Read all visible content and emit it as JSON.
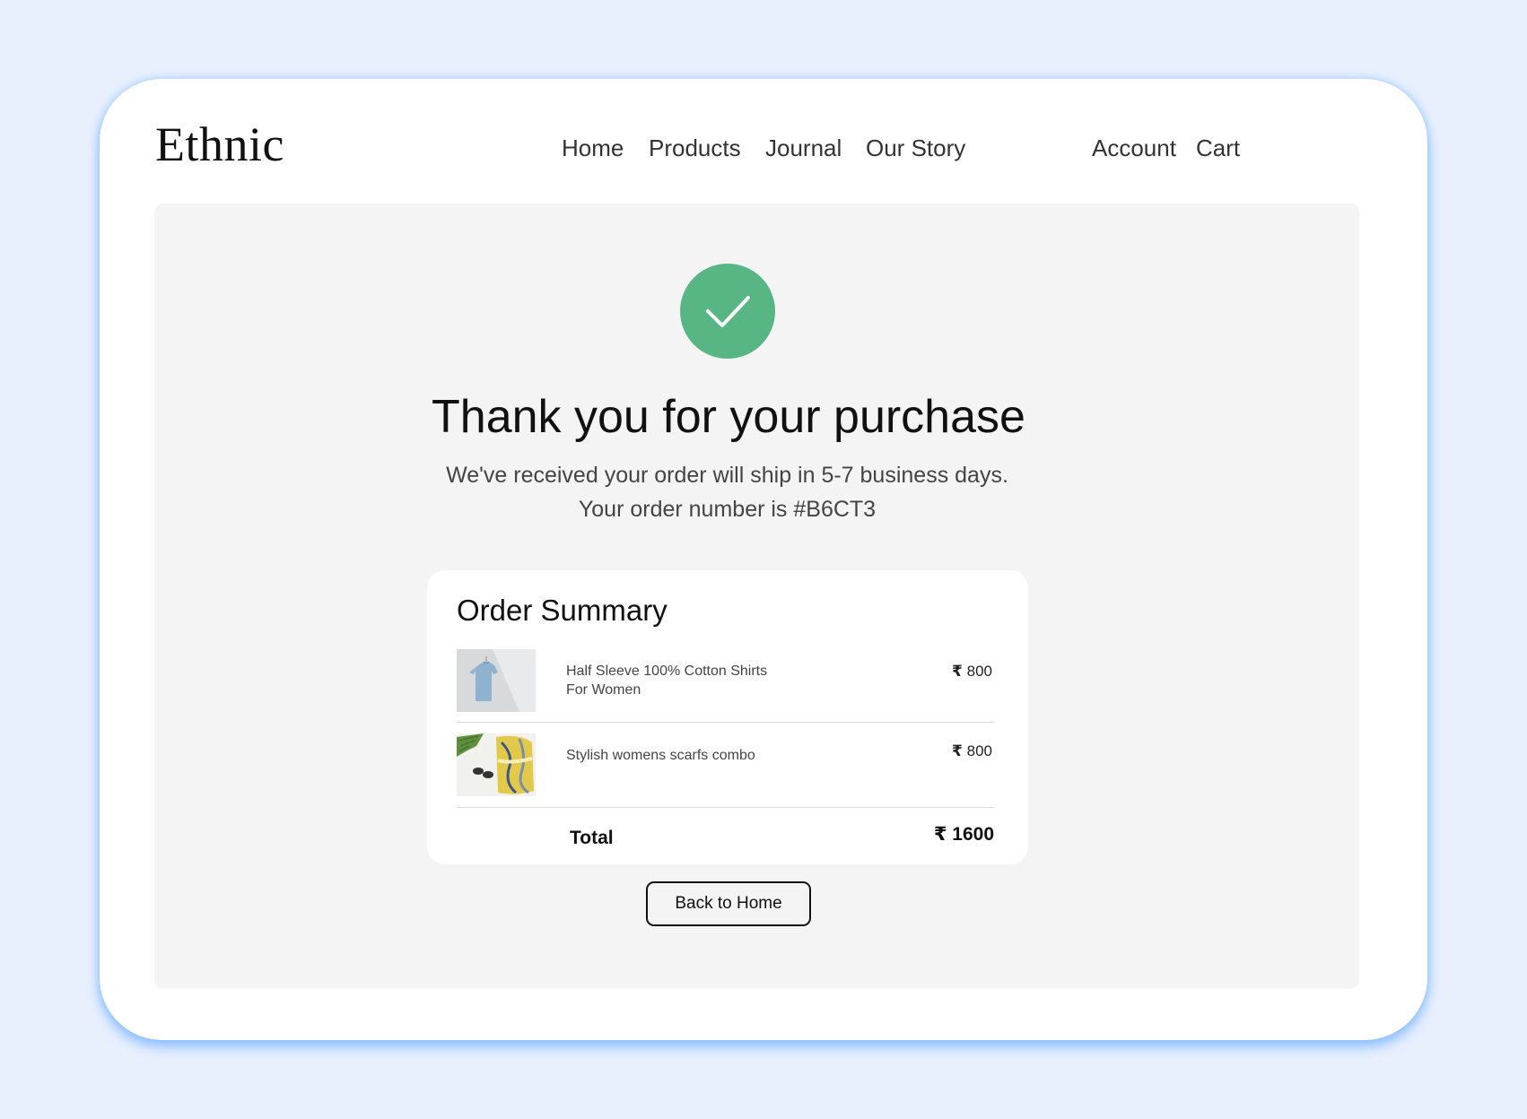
{
  "brand": {
    "logo_text": "Ethnic"
  },
  "nav": {
    "links": [
      "Home",
      "Products",
      "Journal",
      "Our Story"
    ],
    "account_label": "Account",
    "cart_label": "Cart"
  },
  "confirmation": {
    "icon": "checkmark-icon",
    "title": "Thank you for your purchase",
    "line1": "We've received your order will ship in 5-7 business days.",
    "line2": "Your order number is #B6CT3"
  },
  "order_summary": {
    "title": "Order Summary",
    "currency_symbol": "₹",
    "items": [
      {
        "name_line1": "Half Sleeve 100% Cotton Shirts",
        "name_line2": "For Women",
        "price": "800"
      },
      {
        "name_line1": "Stylish womens scarfs combo",
        "price": "800"
      }
    ],
    "total_label": "Total",
    "total_value": "1600"
  },
  "actions": {
    "back_label": "Back to Home"
  },
  "colors": {
    "page_background": "#e8f0fe",
    "success_green": "#58b684",
    "content_background": "#f4f4f4"
  }
}
